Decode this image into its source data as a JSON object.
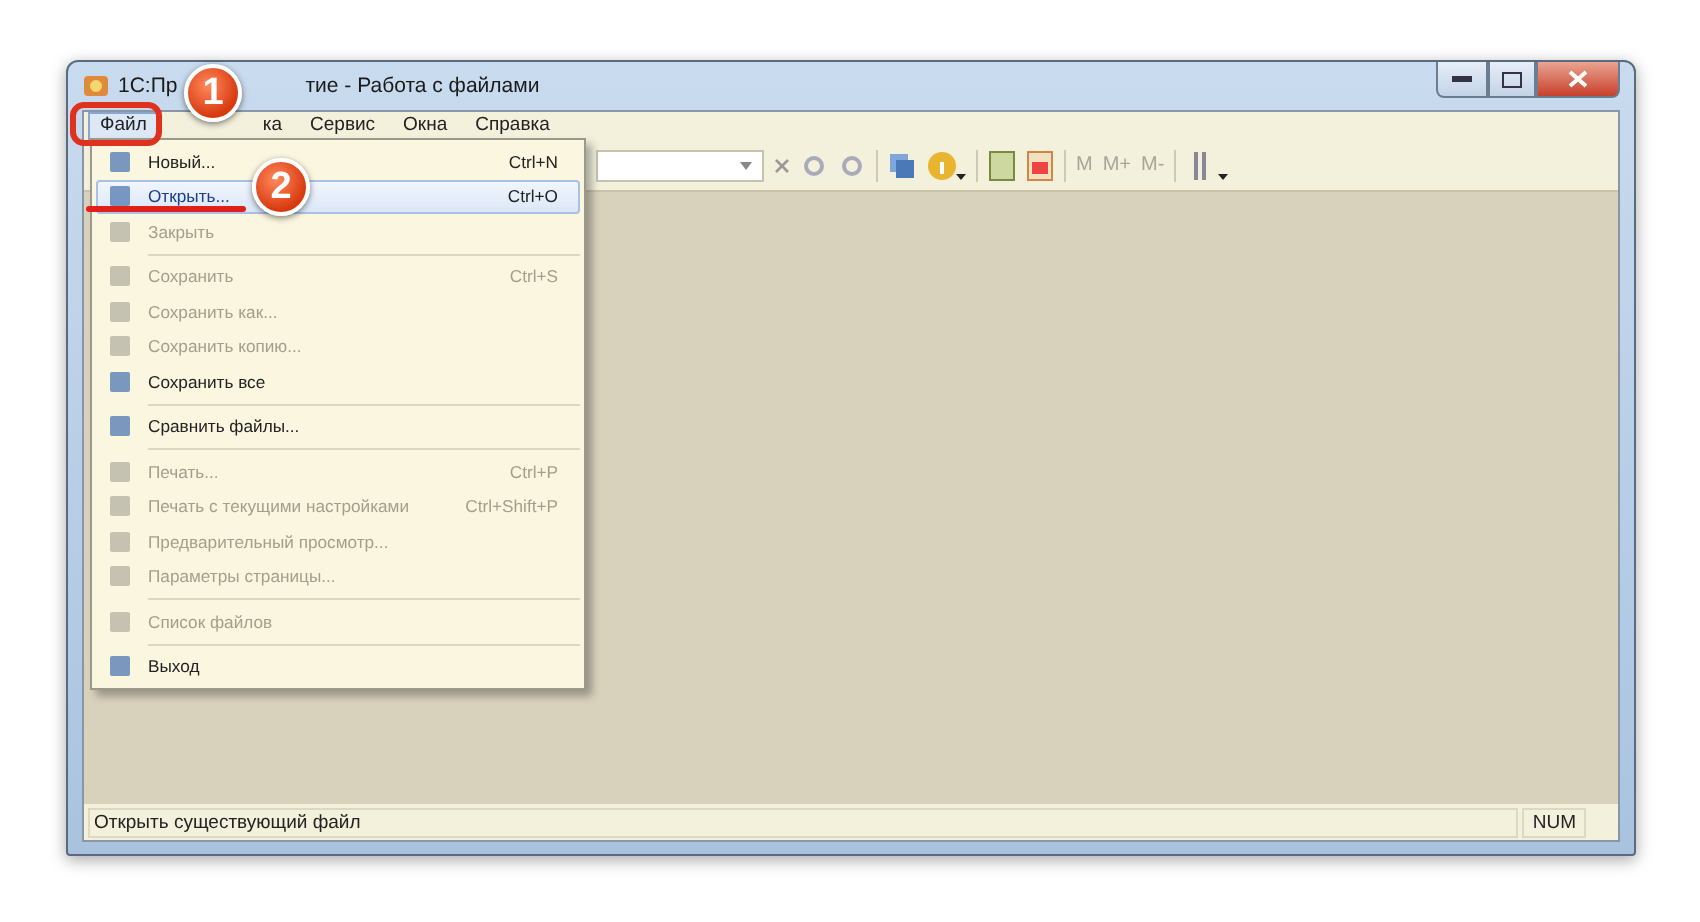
{
  "window": {
    "title_parts": [
      "1С:Пр",
      "тие - Работа с файлами"
    ]
  },
  "menu_bar": [
    {
      "label": "Файл",
      "selected": true
    },
    {
      "label": "ка",
      "selected": false
    },
    {
      "label": "Сервис",
      "selected": false
    },
    {
      "label": "Окна",
      "selected": false
    },
    {
      "label": "Справка",
      "selected": false
    }
  ],
  "toolbar": {
    "memory_buttons": [
      "M",
      "M+",
      "M-"
    ]
  },
  "file_menu": [
    {
      "kind": "item",
      "label": "Новый...",
      "shortcut": "Ctrl+N",
      "disabled": false,
      "selected": false
    },
    {
      "kind": "item",
      "label": "Открыть...",
      "shortcut": "Ctrl+O",
      "disabled": false,
      "selected": true
    },
    {
      "kind": "item",
      "label": "Закрыть",
      "disabled": true,
      "selected": false
    },
    {
      "kind": "separator"
    },
    {
      "kind": "item",
      "label": "Сохранить",
      "shortcut": "Ctrl+S",
      "disabled": true,
      "selected": false
    },
    {
      "kind": "item",
      "label": "Сохранить как...",
      "disabled": true,
      "selected": false
    },
    {
      "kind": "item",
      "label": "Сохранить копию...",
      "disabled": true,
      "selected": false
    },
    {
      "kind": "item",
      "label": "Сохранить все",
      "disabled": false,
      "selected": false
    },
    {
      "kind": "separator"
    },
    {
      "kind": "item",
      "label": "Сравнить файлы...",
      "disabled": false,
      "selected": false
    },
    {
      "kind": "separator"
    },
    {
      "kind": "item",
      "label": "Печать...",
      "shortcut": "Ctrl+P",
      "disabled": true,
      "selected": false
    },
    {
      "kind": "item",
      "label": "Печать с текущими настройками",
      "shortcut": "Ctrl+Shift+P",
      "disabled": true,
      "selected": false
    },
    {
      "kind": "item",
      "label": "Предварительный просмотр...",
      "disabled": true,
      "selected": false
    },
    {
      "kind": "item",
      "label": "Параметры страницы...",
      "disabled": true,
      "selected": false
    },
    {
      "kind": "separator"
    },
    {
      "kind": "item",
      "label": "Список файлов",
      "disabled": true,
      "selected": false
    },
    {
      "kind": "separator"
    },
    {
      "kind": "item",
      "label": "Выход",
      "disabled": false,
      "selected": false
    }
  ],
  "annotations": [
    "1",
    "2"
  ],
  "status_bar": {
    "message": "Открыть существующий файл",
    "num": "NUM"
  }
}
